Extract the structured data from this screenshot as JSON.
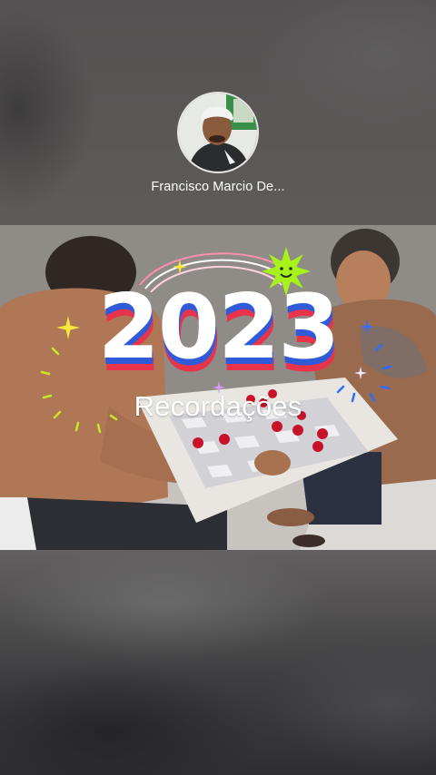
{
  "profile": {
    "name": "Francisco Marcio De..."
  },
  "memory": {
    "year": "2023",
    "title": "Recordações"
  },
  "colors": {
    "accent_red": "#e8334a",
    "accent_blue": "#2f5bd9",
    "sun_green": "#a6f21a"
  }
}
